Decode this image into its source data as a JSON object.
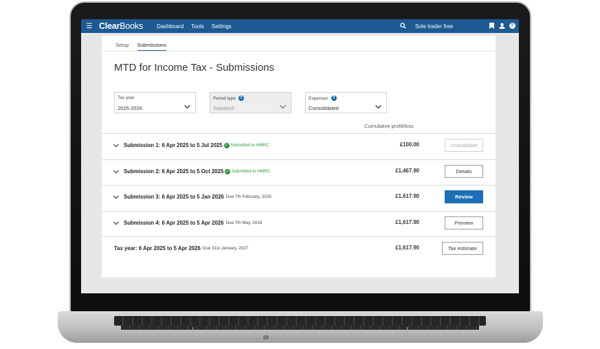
{
  "app": {
    "brand_bold": "Clear",
    "brand_rest": "Books",
    "nav": [
      "Dashboard",
      "Tools",
      "Settings"
    ],
    "plan_label": "Sole trader free",
    "icons": [
      "menu-icon",
      "search-icon",
      "bookmark-icon",
      "user-icon",
      "help-icon"
    ],
    "accent_color": "#1d5a93"
  },
  "tabs": [
    {
      "label": "Setup",
      "active": false
    },
    {
      "label": "Submissions",
      "active": true
    }
  ],
  "page_title": "MTD for Income Tax - Submissions",
  "filters": {
    "tax_year": {
      "label": "Tax year",
      "value": "2025-2026"
    },
    "period_type": {
      "label": "Period type",
      "value": "Standard",
      "disabled": true
    },
    "expenses": {
      "label": "Expenses",
      "value": "Consolidated"
    }
  },
  "column_header": "Cumulative profit/loss",
  "submissions": [
    {
      "title": "Submission 1: 6 Apr 2025 to 5 Jul 2025",
      "status": "Submitted to HMRC",
      "due": "",
      "amount": "£100.00",
      "button": "Unavailable",
      "button_state": "disabled"
    },
    {
      "title": "Submission 2: 6 Apr 2025 to 5 Oct 2025",
      "status": "Submitted to HMRC",
      "due": "",
      "amount": "£1,467.90",
      "button": "Details",
      "button_state": "default"
    },
    {
      "title": "Submission 3: 6 Apr 2025 to 5 Jan 2026",
      "status": "",
      "due": "Due 7th February, 2026",
      "amount": "£1,617.90",
      "button": "Review",
      "button_state": "primary"
    },
    {
      "title": "Submission 4: 6 Apr 2025 to 5 Apr 2026",
      "status": "",
      "due": "Due 7th May, 2026",
      "amount": "£1,617.90",
      "button": "Preview",
      "button_state": "default"
    }
  ],
  "tax_year_row": {
    "title": "Tax year: 6 Apr 2025 to 5 Apr 2026",
    "due": "Due 31st January, 2027",
    "amount": "£1,617.90",
    "button": "Tax estimate"
  },
  "colors": {
    "success": "#2f9a3a",
    "primary_button": "#1d6fb5"
  }
}
